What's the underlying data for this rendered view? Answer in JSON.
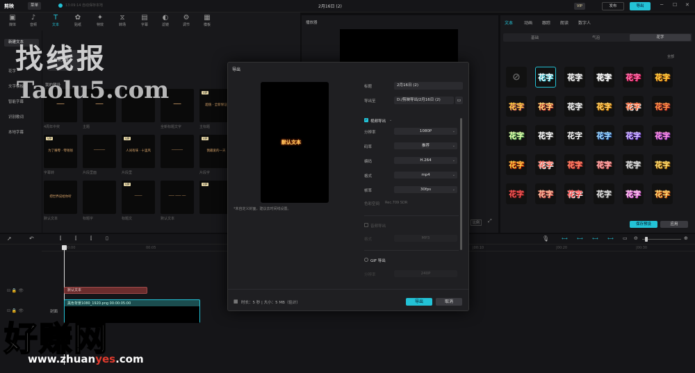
{
  "window": {
    "logo": "剪映",
    "menu_label": "菜单",
    "autosave": "13:09:14 自动保存本地",
    "title": "2月16日 (2)",
    "vip_badge": "VIP",
    "share_label": "发布",
    "export_label": "导出",
    "controls": [
      "─",
      "☐",
      "✕"
    ]
  },
  "toolbar": {
    "items": [
      {
        "label": "媒体",
        "icon": "▣"
      },
      {
        "label": "音频",
        "icon": "♪"
      },
      {
        "label": "文本",
        "icon": "T"
      },
      {
        "label": "贴纸",
        "icon": "✿"
      },
      {
        "label": "特效",
        "icon": "✦"
      },
      {
        "label": "转场",
        "icon": "⧖"
      },
      {
        "label": "字幕",
        "icon": "▤"
      },
      {
        "label": "滤镜",
        "icon": "◐"
      },
      {
        "label": "调节",
        "icon": "⚙"
      },
      {
        "label": "模板",
        "icon": "▦"
      }
    ]
  },
  "left_nav": {
    "items": [
      "新建文本",
      "花字",
      "文字模板",
      "智能字幕",
      "识别歌词",
      "本地字幕"
    ],
    "section_label": "默认文本",
    "my_presets": "我的预设"
  },
  "templates": {
    "cards": [
      {
        "label": "4周年中奖",
        "text": "━━━━",
        "vip": false
      },
      {
        "label": "主题",
        "text": "━━━━",
        "vip": false
      },
      {
        "label": "",
        "text": "",
        "vip": false
      },
      {
        "label": "全新标题文字",
        "text": "━━━━",
        "vip": false
      },
      {
        "label": "主标题",
        "text": "超值 · 全新保证",
        "vip": true
      },
      {
        "label": "字幕转",
        "text": "为了赚零 · 零钱钱",
        "vip": true
      },
      {
        "label": "片段里面",
        "text": "──────",
        "vip": false
      },
      {
        "label": "片段里",
        "text": "人间有味 · 十里风",
        "vip": true
      },
      {
        "label": "",
        "text": "──────",
        "vip": false
      },
      {
        "label": "片段字",
        "text": "我最爱的一天",
        "vip": true
      },
      {
        "label": "默认文本",
        "text": "把世界说给你听",
        "vip": false
      },
      {
        "label": "标题字",
        "text": "",
        "vip": false
      },
      {
        "label": "标题文",
        "text": "────",
        "vip": true
      },
      {
        "label": "默认文本",
        "text": "─── ─── ──",
        "vip": false
      },
      {
        "label": "",
        "text": "",
        "vip": true
      }
    ]
  },
  "player": {
    "title": "播放器",
    "ratio_btn": "比例",
    "fullscreen_icon": "⤢"
  },
  "right_panel": {
    "tabs": [
      "文本",
      "动画",
      "跟踪",
      "朗读",
      "数字人"
    ],
    "subtabs": [
      "基础",
      "气泡",
      "花字"
    ],
    "section": "全部",
    "sample": "花字",
    "save_preset": "保存预设",
    "apply": "应用"
  },
  "dialog": {
    "title": "导出",
    "preview_text": "默认文本",
    "preview_note": "*未自定义封面，建议去时间线设置。",
    "name_label": "标题",
    "name_value": "2月16日 (2)",
    "path_label": "导出至",
    "path_value": "D:/剪映导出/2月16日 (2)",
    "video_section": "视频导出",
    "fields": [
      {
        "label": "分辨率",
        "value": "1080P"
      },
      {
        "label": "码率",
        "value": "推荐"
      },
      {
        "label": "编码",
        "value": "H.264"
      },
      {
        "label": "格式",
        "value": "mp4"
      },
      {
        "label": "帧率",
        "value": "30fps"
      }
    ],
    "color_label": "色彩空间",
    "color_value": "Rec.709 SDR",
    "audio_section": "音频导出",
    "audio_field_label": "格式",
    "audio_field_value": "MP3",
    "gif_section": "GIF 导出",
    "gif_field_label": "分辨率",
    "gif_field_value": "240P",
    "footer": "时长：5 秒 | 大小：5 MB（估计）",
    "export_btn": "导出",
    "cancel_btn": "取消"
  },
  "timeline": {
    "ticks": [
      "00:00",
      "00:05",
      "|00:10",
      "|00:20",
      "|00:30"
    ],
    "text_clip": "默认文本",
    "video_clip": "黑色背景1080_1920.png  00:00:05:00",
    "cover_label": "封面"
  },
  "watermarks": {
    "top_cn": "找线报",
    "top_en": "Taolu5.com",
    "bottom_cn": "好赚网",
    "bottom_url_a": "www.zhuan",
    "bottom_url_b": "yes",
    "bottom_url_c": ".com"
  }
}
